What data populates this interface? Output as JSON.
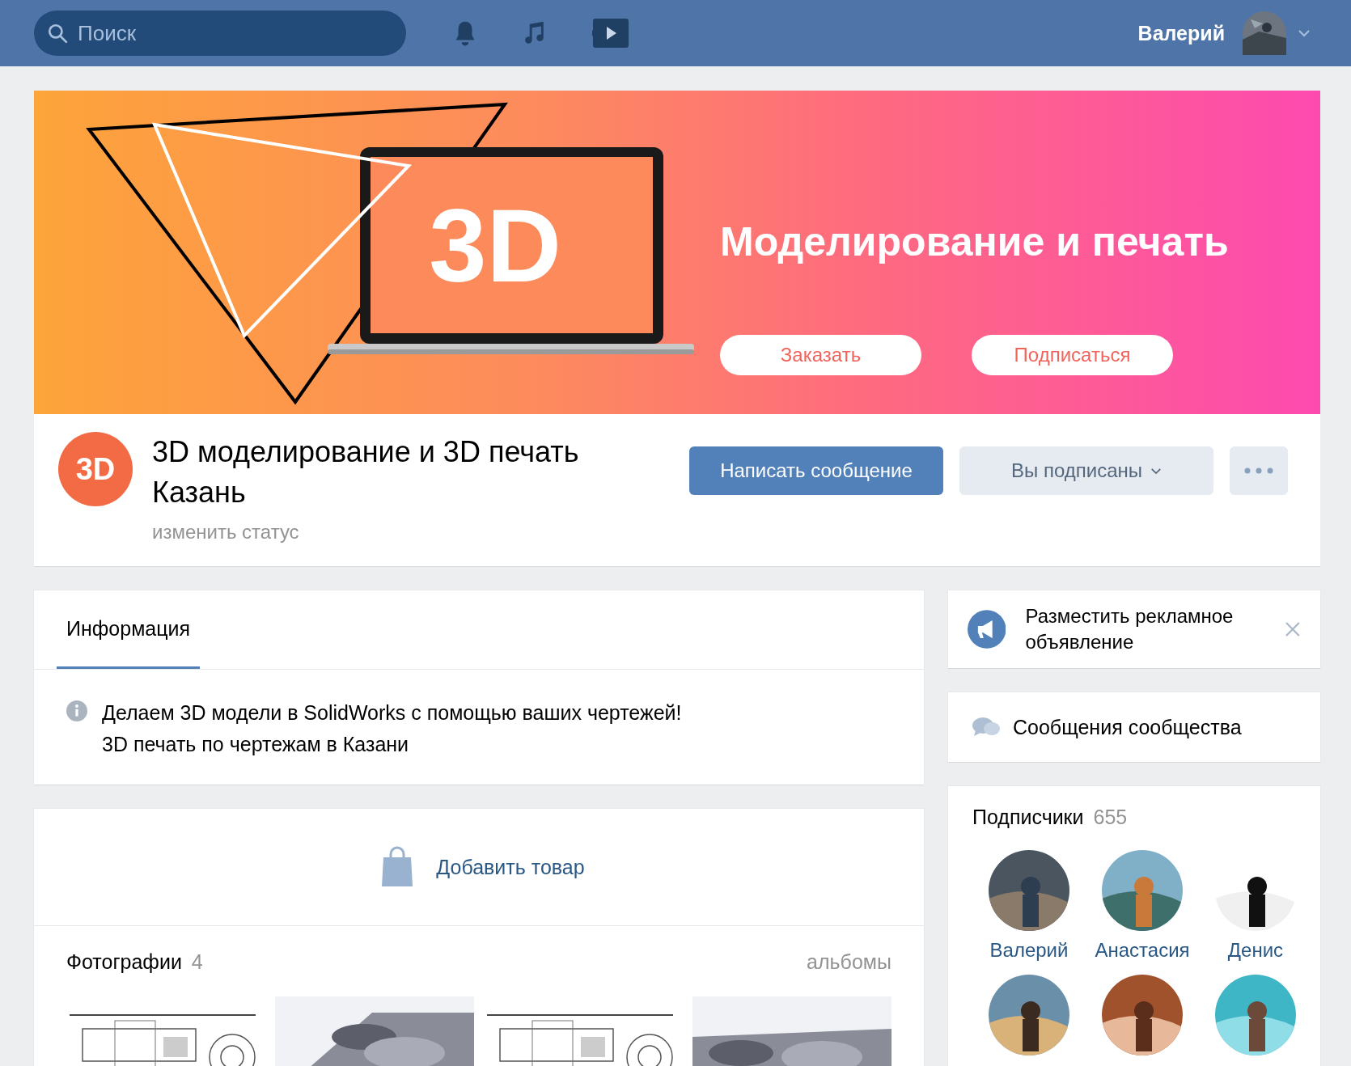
{
  "top_bar": {
    "search": {
      "placeholder": "Поиск"
    },
    "user_name": "Валерий"
  },
  "cover": {
    "logo_text": "3D",
    "headline": "Моделирование и печать",
    "buttons": [
      "Заказать",
      "Подписаться"
    ]
  },
  "community": {
    "avatar_text": "3D",
    "name": "3D моделирование и 3D печать Казань",
    "status": "изменить статус",
    "actions": [
      {
        "kind": "primary",
        "label": "Написать сообщение"
      },
      {
        "kind": "dropdown",
        "label": "Вы подписаны"
      },
      {
        "kind": "more"
      }
    ]
  },
  "info": {
    "tabs": [
      {
        "label": "Информация",
        "selected": true
      }
    ],
    "lines": [
      "Делаем 3D модели в SolidWorks с помощью ваших чертежей!",
      "3D печать по чертежам в Казани"
    ]
  },
  "goods": {
    "add_label": "Добавить товар"
  },
  "photos": {
    "title": "Фотографии",
    "count": "4",
    "albums_link": "альбомы",
    "items": [
      {
        "kind": "picture"
      },
      {
        "kind": "picture"
      },
      {
        "kind": "picture"
      },
      {
        "kind": "picture"
      }
    ]
  },
  "sidebar": {
    "ad": {
      "text": "Разместить рекламное объявление"
    },
    "messages": {
      "label": "Сообщения сообщества"
    },
    "followers": {
      "title": "Подписчики",
      "count": "655",
      "people": [
        {
          "name": "Валерий",
          "kind": "picture"
        },
        {
          "name": "Анастасия",
          "kind": "picture"
        },
        {
          "name": "Денис",
          "kind": "picture"
        },
        {
          "kind": "picture"
        },
        {
          "kind": "picture"
        },
        {
          "kind": "picture"
        }
      ]
    }
  }
}
